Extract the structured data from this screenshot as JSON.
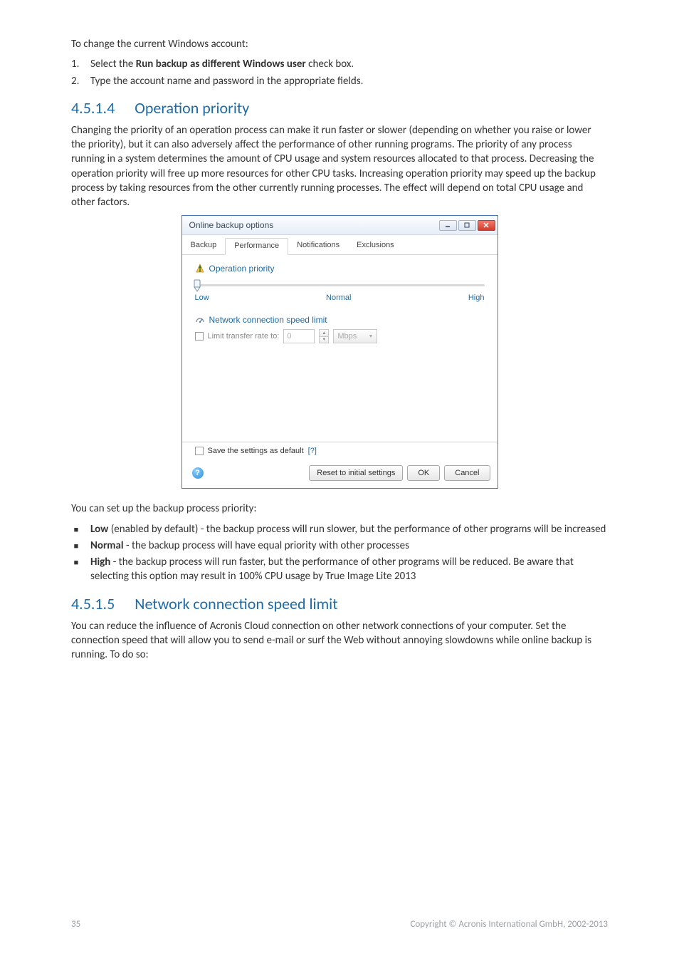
{
  "intro_p": "To change the current Windows account:",
  "steps": {
    "s1_pre": "Select the ",
    "s1_bold": "Run backup as different Windows user",
    "s1_post": " check box.",
    "s2": "Type the account name and password in the appropriate fields."
  },
  "h2_1": {
    "num": "4.5.1.4",
    "title": "Operation priority"
  },
  "para_1": "Changing the priority of an operation process can make it run faster or slower (depending on whether you raise or lower the priority), but it can also adversely affect the performance of other running programs. The priority of any process running in a system determines the amount of CPU usage and system resources allocated to that process. Decreasing the operation priority will free up more resources for other CPU tasks. Increasing operation priority may speed up the backup process by taking resources from the other currently running processes. The effect will depend on total CPU usage and other factors.",
  "dlg": {
    "title": "Online backup options",
    "tabs": [
      "Backup",
      "Performance",
      "Notifications",
      "Exclusions"
    ],
    "active_tab_index": 1,
    "section_priority": "Operation priority",
    "slider_labels": {
      "low": "Low",
      "normal": "Normal",
      "high": "High"
    },
    "section_net": "Network connection speed limit",
    "limit_label": "Limit transfer rate to:",
    "limit_value": "0",
    "limit_unit": "Mbps",
    "save_default": "Save the settings as default",
    "save_default_q": "[?]",
    "btn_reset": "Reset to initial settings",
    "btn_ok": "OK",
    "btn_cancel": "Cancel"
  },
  "post_dlg_p": "You can set up the backup process priority:",
  "bullets": {
    "b1_bold": "Low",
    "b1_text": " (enabled by default) - the backup process will run slower, but the performance of other programs will be increased",
    "b2_bold": "Normal",
    "b2_text": " - the backup process will have equal priority with other processes",
    "b3_bold": "High",
    "b3_text": " - the backup process will run faster, but the performance of other programs will be reduced. Be aware that selecting this option may result in 100% CPU usage by True Image Lite 2013"
  },
  "h2_2": {
    "num": "4.5.1.5",
    "title": "Network connection speed limit"
  },
  "para_2": "You can reduce the influence of Acronis Cloud connection on other network connections of your computer. Set the connection speed that will allow you to send e-mail or surf the Web without annoying slowdowns while online backup is running. To do so:",
  "footer": {
    "page": "35",
    "copyright": "Copyright © Acronis International GmbH, 2002-2013"
  }
}
